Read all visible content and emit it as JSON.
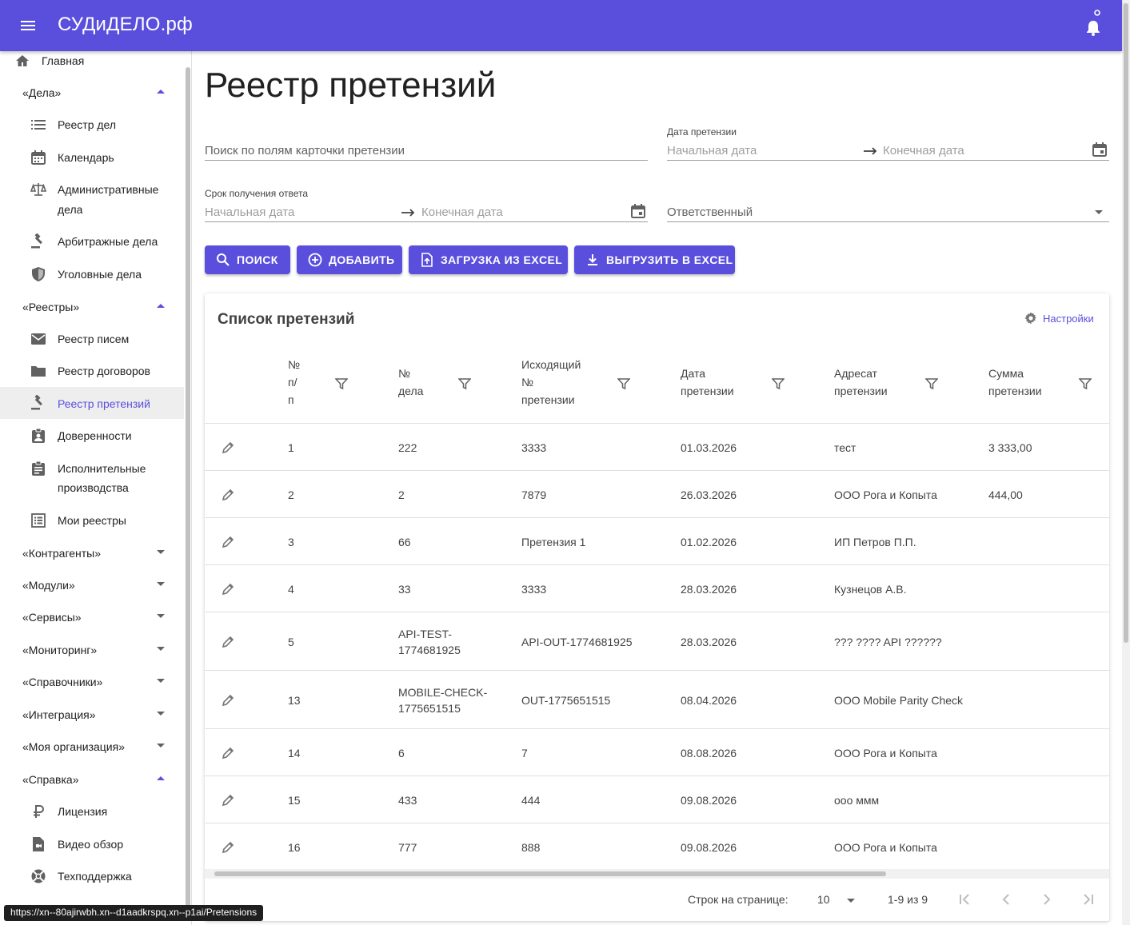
{
  "app": {
    "title": "СУДиДЕЛО.рф",
    "accent": "#5a4fdc"
  },
  "sidebar": {
    "home": "Главная",
    "groups": {
      "cases": "«Дела»",
      "registries": "«Реестры»",
      "counterparties": "«Контрагенты»",
      "modules": "«Модули»",
      "services": "«Сервисы»",
      "monitoring": "«Мониторинг»",
      "directories": "«Справочники»",
      "integration": "«Интеграция»",
      "my_org": "«Моя организация»",
      "help": "«Справка»"
    },
    "items": {
      "case_registry": "Реестр дел",
      "calendar": "Календарь",
      "admin_1": "Административные",
      "admin_2": "дела",
      "arbitration": "Арбитражные дела",
      "criminal": "Уголовные дела",
      "letters": "Реестр писем",
      "contracts": "Реестр договоров",
      "claims": "Реестр претензий",
      "powers": "Доверенности",
      "enforcement_1": "Исполнительные",
      "enforcement_2": "производства",
      "my_registries": "Мои реестры",
      "license": "Лицензия",
      "video": "Видео обзор",
      "support": "Техподдержка"
    }
  },
  "page": {
    "title": "Реестр претензий"
  },
  "filters": {
    "search_placeholder": "Поиск по полям карточки претензии",
    "claim_date_label": "Дата претензии",
    "start_date": "Начальная дата",
    "end_date": "Конечная дата",
    "response_label": "Срок получения ответа",
    "responsible": "Ответственный"
  },
  "buttons": {
    "search": "ПОИСК",
    "add": "ДОБАВИТЬ",
    "import": "ЗАГРУЗКА ИЗ EXCEL",
    "export": "ВЫГРУЗИТЬ В EXCEL"
  },
  "table": {
    "title": "Список претензий",
    "settings": "Настройки",
    "headers": {
      "num": [
        "№",
        "п/",
        "п"
      ],
      "case": [
        "№",
        "дела"
      ],
      "outgoing": [
        "Исходящий",
        "№",
        "претензии"
      ],
      "date": [
        "Дата",
        "претензии"
      ],
      "addressee": [
        "Адресат",
        "претензии"
      ],
      "amount": [
        "Сумма",
        "претензии"
      ]
    },
    "rows": [
      {
        "num": "1",
        "case": "222",
        "case2": "",
        "out": "3333",
        "date": "01.03.2026",
        "addr": "тест",
        "sum": "3 333,00"
      },
      {
        "num": "2",
        "case": "2",
        "case2": "",
        "out": "7879",
        "date": "26.03.2026",
        "addr": "ООО Рога и Копыта",
        "sum": "444,00"
      },
      {
        "num": "3",
        "case": "66",
        "case2": "",
        "out": "Претензия 1",
        "date": "01.02.2026",
        "addr": "ИП Петров П.П.",
        "sum": ""
      },
      {
        "num": "4",
        "case": "33",
        "case2": "",
        "out": "3333",
        "date": "28.03.2026",
        "addr": "Кузнецов А.В.",
        "sum": ""
      },
      {
        "num": "5",
        "case": "API-TEST-",
        "case2": "1774681925",
        "out": "API-OUT-1774681925",
        "date": "28.03.2026",
        "addr": "??? ???? API ??????",
        "sum": ""
      },
      {
        "num": "13",
        "case": "MOBILE-CHECK-",
        "case2": "1775651515",
        "out": "OUT-1775651515",
        "date": "08.04.2026",
        "addr": "ООО Mobile Parity Check",
        "sum": ""
      },
      {
        "num": "14",
        "case": "6",
        "case2": "",
        "out": "7",
        "date": "08.08.2026",
        "addr": "ООО Рога и Копыта",
        "sum": ""
      },
      {
        "num": "15",
        "case": "433",
        "case2": "",
        "out": "444",
        "date": "09.08.2026",
        "addr": "ооо ммм",
        "sum": ""
      },
      {
        "num": "16",
        "case": "777",
        "case2": "",
        "out": "888",
        "date": "09.08.2026",
        "addr": "ООО Рога и Копыта",
        "sum": ""
      }
    ],
    "pagination": {
      "rows_label": "Строк на странице:",
      "rows_value": "10",
      "range": "1-9 из 9"
    }
  },
  "status_url": "https://xn--80ajirwbh.xn--d1aadkrspq.xn--p1ai/Pretensions"
}
